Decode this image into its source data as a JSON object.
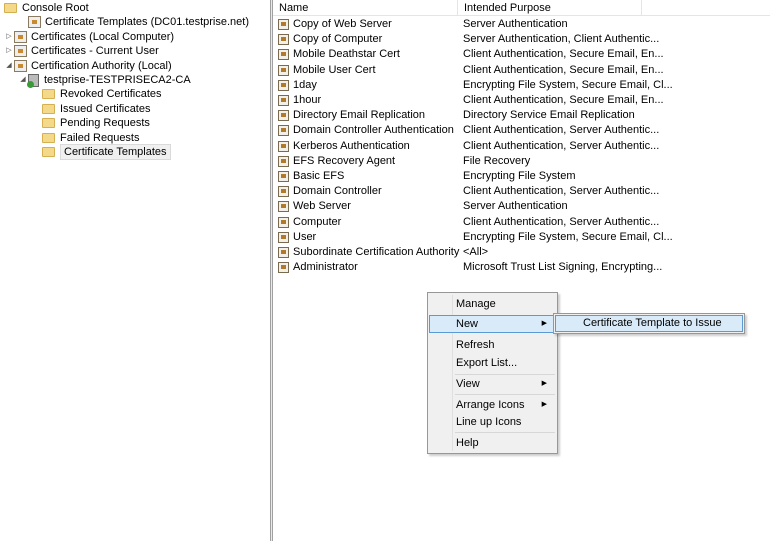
{
  "tree": [
    {
      "label": "Console Root",
      "icon": "folder-icon",
      "expander": ""
    },
    {
      "label": "Certificate Templates (DC01.testprise.net)",
      "icon": "certificate-templates-icon",
      "expander": ""
    },
    {
      "label": "Certificates (Local Computer)",
      "icon": "certificates-icon",
      "expander": "▷"
    },
    {
      "label": "Certificates - Current User",
      "icon": "certificates-icon",
      "expander": "▷"
    },
    {
      "label": "Certification Authority (Local)",
      "icon": "ca-icon",
      "expander": "◢"
    },
    {
      "label": "testprise-TESTPRISECA2-CA",
      "icon": "ca-server-icon",
      "expander": "◢"
    },
    {
      "label": "Revoked Certificates",
      "icon": "folder-icon",
      "expander": ""
    },
    {
      "label": "Issued Certificates",
      "icon": "folder-icon",
      "expander": ""
    },
    {
      "label": "Pending Requests",
      "icon": "folder-icon",
      "expander": ""
    },
    {
      "label": "Failed Requests",
      "icon": "folder-icon",
      "expander": ""
    },
    {
      "label": "Certificate Templates",
      "icon": "folder-icon",
      "expander": "",
      "selected": true
    }
  ],
  "list": {
    "columns": [
      "Name",
      "Intended Purpose"
    ],
    "rows": [
      {
        "name": "Copy of Web Server",
        "purpose": "Server Authentication"
      },
      {
        "name": "Copy of Computer",
        "purpose": "Server Authentication, Client Authentic..."
      },
      {
        "name": "Mobile Deathstar Cert",
        "purpose": "Client Authentication, Secure Email, En..."
      },
      {
        "name": "Mobile User Cert",
        "purpose": "Client Authentication, Secure Email, En..."
      },
      {
        "name": "1day",
        "purpose": "Encrypting File System, Secure Email, Cl..."
      },
      {
        "name": "1hour",
        "purpose": "Client Authentication, Secure Email, En..."
      },
      {
        "name": "Directory Email Replication",
        "purpose": "Directory Service Email Replication"
      },
      {
        "name": "Domain Controller Authentication",
        "purpose": "Client Authentication, Server Authentic..."
      },
      {
        "name": "Kerberos Authentication",
        "purpose": "Client Authentication, Server Authentic..."
      },
      {
        "name": "EFS Recovery Agent",
        "purpose": "File Recovery"
      },
      {
        "name": "Basic EFS",
        "purpose": "Encrypting File System"
      },
      {
        "name": "Domain Controller",
        "purpose": "Client Authentication, Server Authentic..."
      },
      {
        "name": "Web Server",
        "purpose": "Server Authentication"
      },
      {
        "name": "Computer",
        "purpose": "Client Authentication, Server Authentic..."
      },
      {
        "name": "User",
        "purpose": "Encrypting File System, Secure Email, Cl..."
      },
      {
        "name": "Subordinate Certification Authority",
        "purpose": "<All>"
      },
      {
        "name": "Administrator",
        "purpose": "Microsoft Trust List Signing, Encrypting..."
      }
    ]
  },
  "context_menu": {
    "manage": "Manage",
    "new": "New",
    "refresh": "Refresh",
    "export_list": "Export List...",
    "view": "View",
    "arrange_icons": "Arrange Icons",
    "line_up_icons": "Line up Icons",
    "help": "Help",
    "submenu_arrow": "▶"
  },
  "submenu": {
    "certificate_template_to_issue": "Certificate Template to Issue"
  }
}
